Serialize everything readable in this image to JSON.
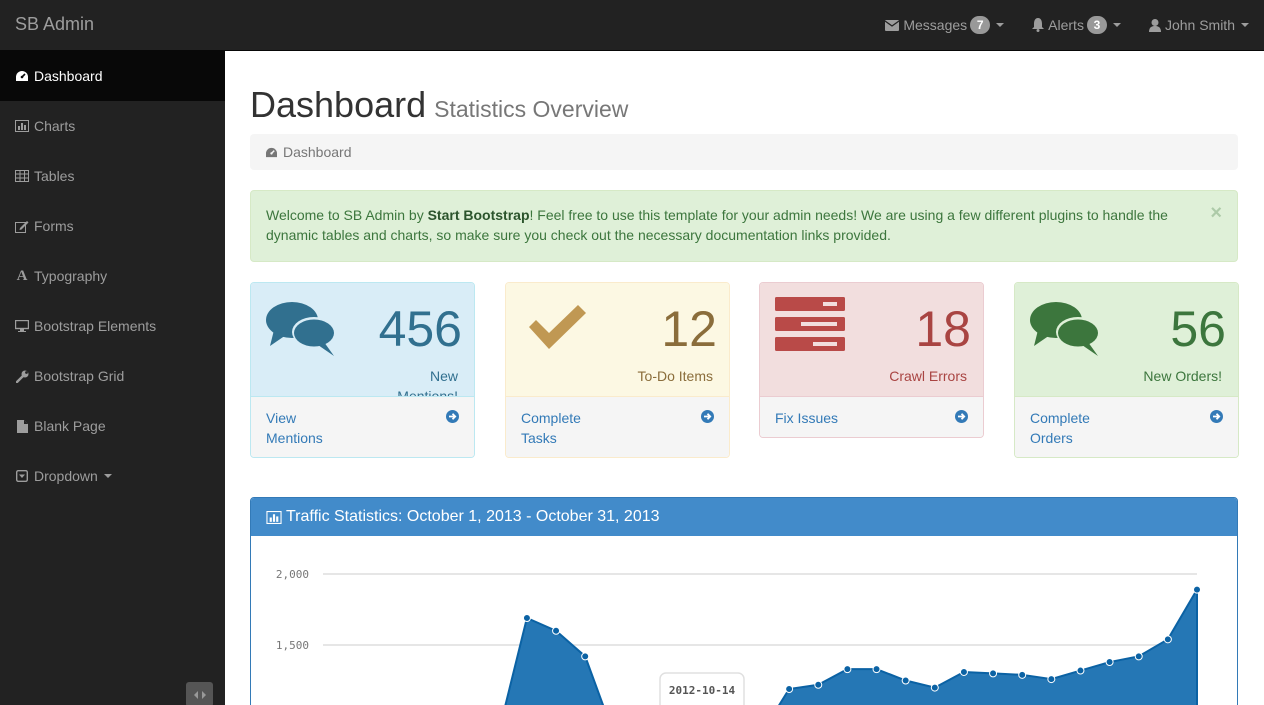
{
  "app": {
    "brand": "SB Admin"
  },
  "navbar": {
    "messages": {
      "label": "Messages",
      "count": "7"
    },
    "alerts": {
      "label": "Alerts",
      "count": "3"
    },
    "user": {
      "label": "John Smith"
    }
  },
  "sidebar": {
    "items": [
      {
        "label": "Dashboard",
        "icon": "dashboard-icon"
      },
      {
        "label": "Charts",
        "icon": "bar-chart-icon"
      },
      {
        "label": "Tables",
        "icon": "table-icon"
      },
      {
        "label": "Forms",
        "icon": "edit-icon"
      },
      {
        "label": "Typography",
        "icon": "font-icon"
      },
      {
        "label": "Bootstrap Elements",
        "icon": "desktop-icon"
      },
      {
        "label": "Bootstrap Grid",
        "icon": "wrench-icon"
      },
      {
        "label": "Blank Page",
        "icon": "file-icon"
      },
      {
        "label": "Dropdown",
        "icon": "caret-square-icon"
      }
    ]
  },
  "page": {
    "title": "Dashboard",
    "subtitle": "Statistics Overview",
    "breadcrumb": "Dashboard"
  },
  "alert": {
    "before": "Welcome to SB Admin by ",
    "strong": "Start Bootstrap",
    "after": "! Feel free to use this template for your admin needs! We are using a few different plugins to handle the dynamic tables and charts, so make sure you check out the necessary documentation links provided.",
    "close": "×"
  },
  "cards": [
    {
      "number": "456",
      "label": "New Mentions!",
      "footer": "View Mentions",
      "color": "#31708f"
    },
    {
      "number": "12",
      "label": "To-Do Items",
      "footer": "Complete Tasks",
      "color": "#8a6d3b"
    },
    {
      "number": "18",
      "label": "Crawl Errors",
      "footer": "Fix Issues",
      "color": "#a94442"
    },
    {
      "number": "56",
      "label": "New Orders!",
      "footer": "Complete Orders",
      "color": "#3c763d"
    }
  ],
  "traffic": {
    "title": "Traffic Statistics: October 1, 2013 - October 31, 2013"
  },
  "chart_data": {
    "type": "area",
    "title": "",
    "xlabel": "",
    "ylabel": "",
    "ylim": [
      1000,
      2000
    ],
    "y_ticks": [
      "2,000",
      "1,500"
    ],
    "grid": true,
    "color": "#2577b5",
    "tooltip": "2012-10-14",
    "series": [
      {
        "x": [
          0,
          1,
          2,
          3,
          4,
          5,
          6,
          7,
          8,
          9,
          10,
          11,
          12,
          13,
          14,
          15,
          16,
          17,
          18,
          19,
          20,
          21,
          22,
          23,
          24,
          25,
          26,
          27,
          28,
          29,
          30
        ],
        "values": [
          null,
          null,
          null,
          null,
          null,
          null,
          null,
          1690,
          1600,
          1420,
          null,
          null,
          null,
          null,
          null,
          null,
          1190,
          1220,
          1330,
          1330,
          1250,
          1200,
          1310,
          1300,
          1290,
          1260,
          1320,
          1380,
          1420,
          1540,
          1890
        ]
      }
    ]
  }
}
